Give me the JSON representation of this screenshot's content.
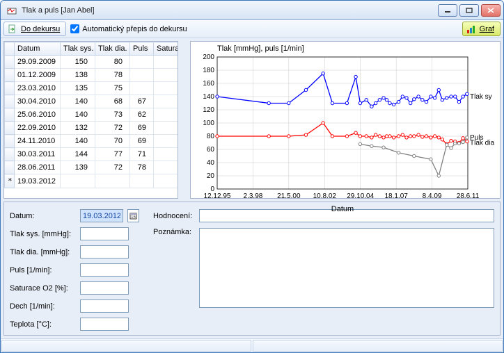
{
  "title": "Tlak a puls [Jan Abel]",
  "toolbar": {
    "do_dekursu": "Do dekursu",
    "auto_prepis": "Automatický přepis do dekursu",
    "graf": "Graf"
  },
  "table": {
    "headers": [
      "Datum",
      "Tlak sys.",
      "Tlak dia.",
      "Puls",
      "Satura"
    ],
    "rows": [
      {
        "date": "29.09.2009",
        "sys": "150",
        "dia": "80",
        "puls": "",
        "sat": ""
      },
      {
        "date": "01.12.2009",
        "sys": "138",
        "dia": "78",
        "puls": "",
        "sat": ""
      },
      {
        "date": "23.03.2010",
        "sys": "135",
        "dia": "75",
        "puls": "",
        "sat": ""
      },
      {
        "date": "30.04.2010",
        "sys": "140",
        "dia": "68",
        "puls": "67",
        "sat": ""
      },
      {
        "date": "25.06.2010",
        "sys": "140",
        "dia": "73",
        "puls": "62",
        "sat": ""
      },
      {
        "date": "22.09.2010",
        "sys": "132",
        "dia": "72",
        "puls": "69",
        "sat": ""
      },
      {
        "date": "24.11.2010",
        "sys": "140",
        "dia": "70",
        "puls": "69",
        "sat": ""
      },
      {
        "date": "30.03.2011",
        "sys": "144",
        "dia": "77",
        "puls": "71",
        "sat": ""
      },
      {
        "date": "28.06.2011",
        "sys": "139",
        "dia": "72",
        "puls": "78",
        "sat": ""
      }
    ],
    "active_row": {
      "marker": "*",
      "date": "19.03.2012"
    }
  },
  "form": {
    "labels": {
      "datum": "Datum:",
      "sys": "Tlak sys. [mmHg]:",
      "dia": "Tlak dia. [mmHg]:",
      "puls": "Puls [1/min]:",
      "sat": "Saturace O2 [%]:",
      "dech": "Dech [1/min]:",
      "teplota": "Teplota [°C]:",
      "hodnoceni": "Hodnocení:",
      "poznamka": "Poznámka:"
    },
    "values": {
      "datum": "19.03.2012"
    }
  },
  "chart_data": {
    "type": "line",
    "title": "Tlak [mmHg], puls [1/min]",
    "xlabel": "Datum",
    "ylim": [
      0,
      200
    ],
    "yticks": [
      0,
      20,
      40,
      60,
      80,
      100,
      120,
      140,
      160,
      180,
      200
    ],
    "xticks": [
      "12.12.95",
      "2.3.98",
      "21.5.00",
      "10.8.02",
      "29.10.04",
      "18.1.07",
      "8.4.09",
      "28.6.11"
    ],
    "x_range_days": [
      0,
      5678
    ],
    "series": [
      {
        "name": "Tlak sy",
        "color": "#0000ff",
        "x": [
          0,
          1170,
          1620,
          2010,
          2400,
          2610,
          2940,
          3140,
          3240,
          3380,
          3500,
          3590,
          3680,
          3770,
          3840,
          3910,
          4000,
          4110,
          4200,
          4290,
          4380,
          4460,
          4560,
          4650,
          4740,
          4840,
          4930,
          5020,
          5100,
          5200,
          5300,
          5390,
          5480,
          5570,
          5660
        ],
        "y": [
          140,
          130,
          130,
          150,
          175,
          130,
          130,
          170,
          130,
          135,
          125,
          130,
          135,
          138,
          135,
          130,
          128,
          132,
          140,
          138,
          130,
          136,
          140,
          135,
          132,
          140,
          138,
          150,
          135,
          138,
          140,
          140,
          132,
          140,
          144
        ]
      },
      {
        "name": "Tlak dia",
        "color": "#ff0000",
        "x": [
          0,
          1170,
          1620,
          2010,
          2400,
          2610,
          2940,
          3140,
          3240,
          3380,
          3500,
          3590,
          3680,
          3770,
          3840,
          3910,
          4000,
          4110,
          4200,
          4290,
          4380,
          4460,
          4560,
          4650,
          4740,
          4840,
          4930,
          5020,
          5100,
          5200,
          5300,
          5390,
          5480,
          5570,
          5660
        ],
        "y": [
          80,
          80,
          80,
          82,
          100,
          80,
          80,
          85,
          80,
          80,
          78,
          82,
          80,
          78,
          80,
          80,
          78,
          80,
          82,
          78,
          80,
          80,
          82,
          79,
          80,
          78,
          80,
          78,
          75,
          68,
          73,
          72,
          70,
          77,
          72
        ]
      },
      {
        "name": "Puls",
        "color": "#808080",
        "x": [
          3240,
          3500,
          3770,
          4110,
          4460,
          4840,
          5020,
          5200,
          5300,
          5390,
          5480,
          5570,
          5660
        ],
        "y": [
          68,
          65,
          63,
          55,
          50,
          45,
          20,
          67,
          62,
          69,
          69,
          71,
          78
        ]
      }
    ],
    "legend_labels": [
      "Tlak sy",
      "Puls",
      "Tlak dia"
    ]
  }
}
